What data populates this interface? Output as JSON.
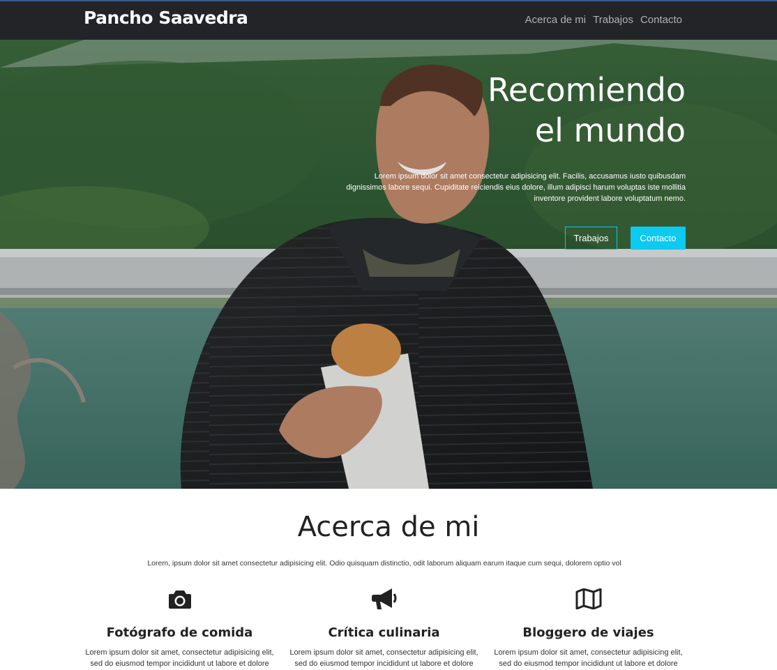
{
  "navbar": {
    "brand": "Pancho Saavedra",
    "links": [
      "Acerca de mi",
      "Trabajos",
      "Contacto"
    ]
  },
  "hero": {
    "title_line1": "Recomiendo",
    "title_line2": "el mundo",
    "text": "Lorem ipsum dolor sit amet consectetur adipisicing elit. Facilis, accusamus iusto quibusdam dignissimos labore sequi. Cupiditate reiciendis eius dolore, illum adipisci harum voluptas iste mollitia inventore provident labore voluptatum nemo.",
    "btn_works": "Trabajos",
    "btn_contact": "Contacto"
  },
  "about": {
    "title": "Acerca de mi",
    "lead": "Lorem, ipsum dolor sit amet consectetur adipisicing elit. Odio quisquam distinctio, odit laborum aliquam earum itaque cum sequi, dolorem optio vol",
    "features": [
      {
        "icon": "camera-icon",
        "title": "Fotógrafo de comida",
        "text": "Lorem ipsum dolor sit amet, consectetur adipisicing elit, sed do eiusmod tempor incididunt ut labore et dolore"
      },
      {
        "icon": "megaphone-icon",
        "title": "Crítica culinaria",
        "text": "Lorem ipsum dolor sit amet, consectetur adipisicing elit, sed do eiusmod tempor incididunt ut labore et dolore"
      },
      {
        "icon": "map-icon",
        "title": "Bloggero de viajes",
        "text": "Lorem ipsum dolor sit amet, consectetur adipisicing elit, sed do eiusmod tempor incididunt ut labore et dolore"
      }
    ]
  },
  "colors": {
    "navbar_bg": "#222428",
    "accent": "#0dcaf0",
    "nav_link": "#aeb3ba"
  }
}
